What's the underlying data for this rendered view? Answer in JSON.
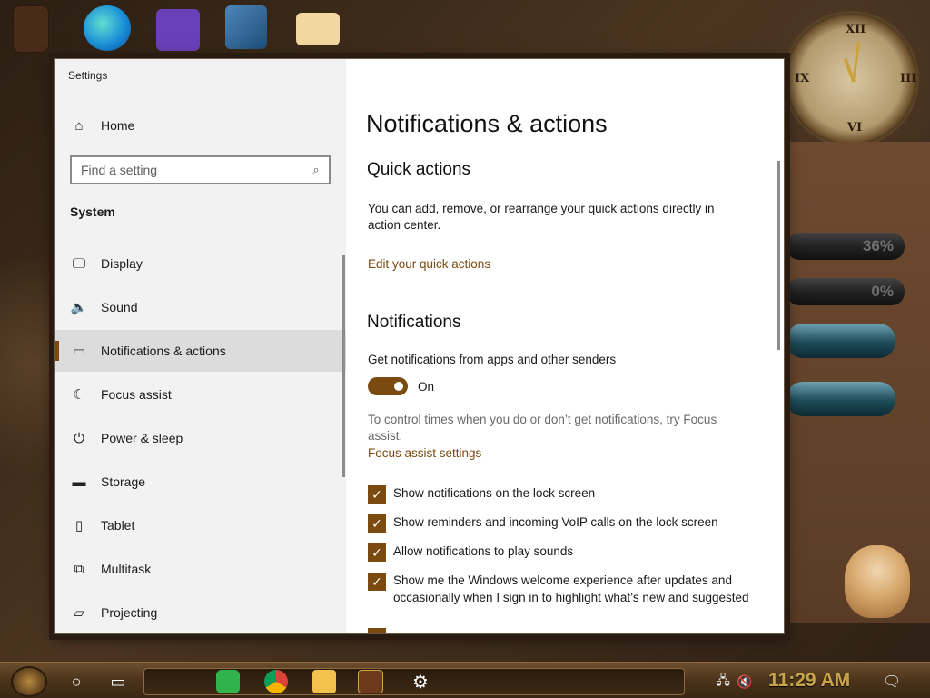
{
  "window": {
    "app_title": "Settings",
    "minimize_label": "—",
    "maximize_label": "☐",
    "close_label": "✕"
  },
  "sidebar": {
    "home_label": "Home",
    "search_placeholder": "Find a setting",
    "group_label": "System",
    "items": [
      {
        "label": "Display",
        "icon": "monitor-icon"
      },
      {
        "label": "Sound",
        "icon": "speaker-icon"
      },
      {
        "label": "Notifications & actions",
        "icon": "notification-icon",
        "selected": true
      },
      {
        "label": "Focus assist",
        "icon": "moon-icon"
      },
      {
        "label": "Power & sleep",
        "icon": "power-icon"
      },
      {
        "label": "Storage",
        "icon": "storage-icon"
      },
      {
        "label": "Tablet",
        "icon": "tablet-icon"
      },
      {
        "label": "Multitask",
        "icon": "multitasking-icon"
      },
      {
        "label": "Projecting",
        "icon": "projecting-icon"
      }
    ]
  },
  "content": {
    "page_title": "Notifications & actions",
    "quick_actions": {
      "title": "Quick actions",
      "description": "You can add, remove, or rearrange your quick actions directly in action center.",
      "edit_link": "Edit your quick actions"
    },
    "notifications": {
      "title": "Notifications",
      "get_label": "Get notifications from apps and other senders",
      "toggle_state": "On",
      "focus_hint": "To control times when you do or don’t get notifications, try Focus assist.",
      "focus_link": "Focus assist settings",
      "checkboxes": [
        {
          "label": "Show notifications on the lock screen",
          "checked": true
        },
        {
          "label": "Show reminders and incoming VoIP calls on the lock screen",
          "checked": true
        },
        {
          "label": "Allow notifications to play sounds",
          "checked": true
        },
        {
          "label": "Show me the Windows welcome experience after updates and occasionally when I sign in to highlight what’s new and suggested",
          "checked": true
        }
      ]
    }
  },
  "desktop": {
    "gauge_1": "36%",
    "gauge_2": "0%"
  },
  "taskbar": {
    "clock": "11:29 AM",
    "task_view_glyph": "▭",
    "search_glyph": "○"
  },
  "colors": {
    "accent": "#7a4a10",
    "sidebar_bg": "#f2f2f2",
    "selected_bg": "#dcdcdc"
  }
}
